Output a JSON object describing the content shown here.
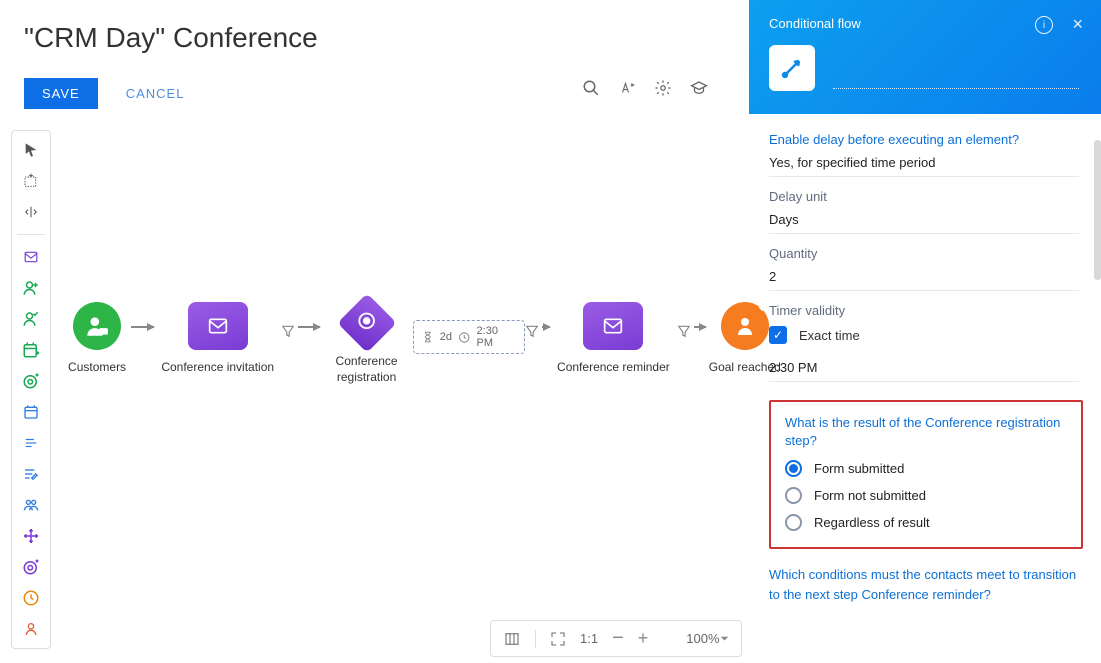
{
  "title": "\"CRM Day\" Conference",
  "actions": {
    "save": "SAVE",
    "cancel": "CANCEL"
  },
  "flow": {
    "start": "Customers",
    "n1": "Conference invitation",
    "n2": "Conference registration",
    "delay": {
      "dur": "2d",
      "time": "2:30 PM"
    },
    "n3": "Conference reminder",
    "goal": "Goal reached"
  },
  "panel": {
    "title": "Conditional flow",
    "delay_q": "Enable delay before executing an element?",
    "delay_a": "Yes, for specified time period",
    "unit_l": "Delay unit",
    "unit_v": "Days",
    "qty_l": "Quantity",
    "qty_v": "2",
    "validity_l": "Timer validity",
    "exact": "Exact time",
    "time": "2:30 PM",
    "result_q": "What is the result of the Conference registration step?",
    "opts": [
      "Form submitted",
      "Form not submitted",
      "Regardless of result"
    ],
    "cond_q": "Which conditions must the contacts meet to transition to the next step Conference reminder?"
  },
  "zoom": {
    "scale": "1:1",
    "pct": "100%"
  }
}
